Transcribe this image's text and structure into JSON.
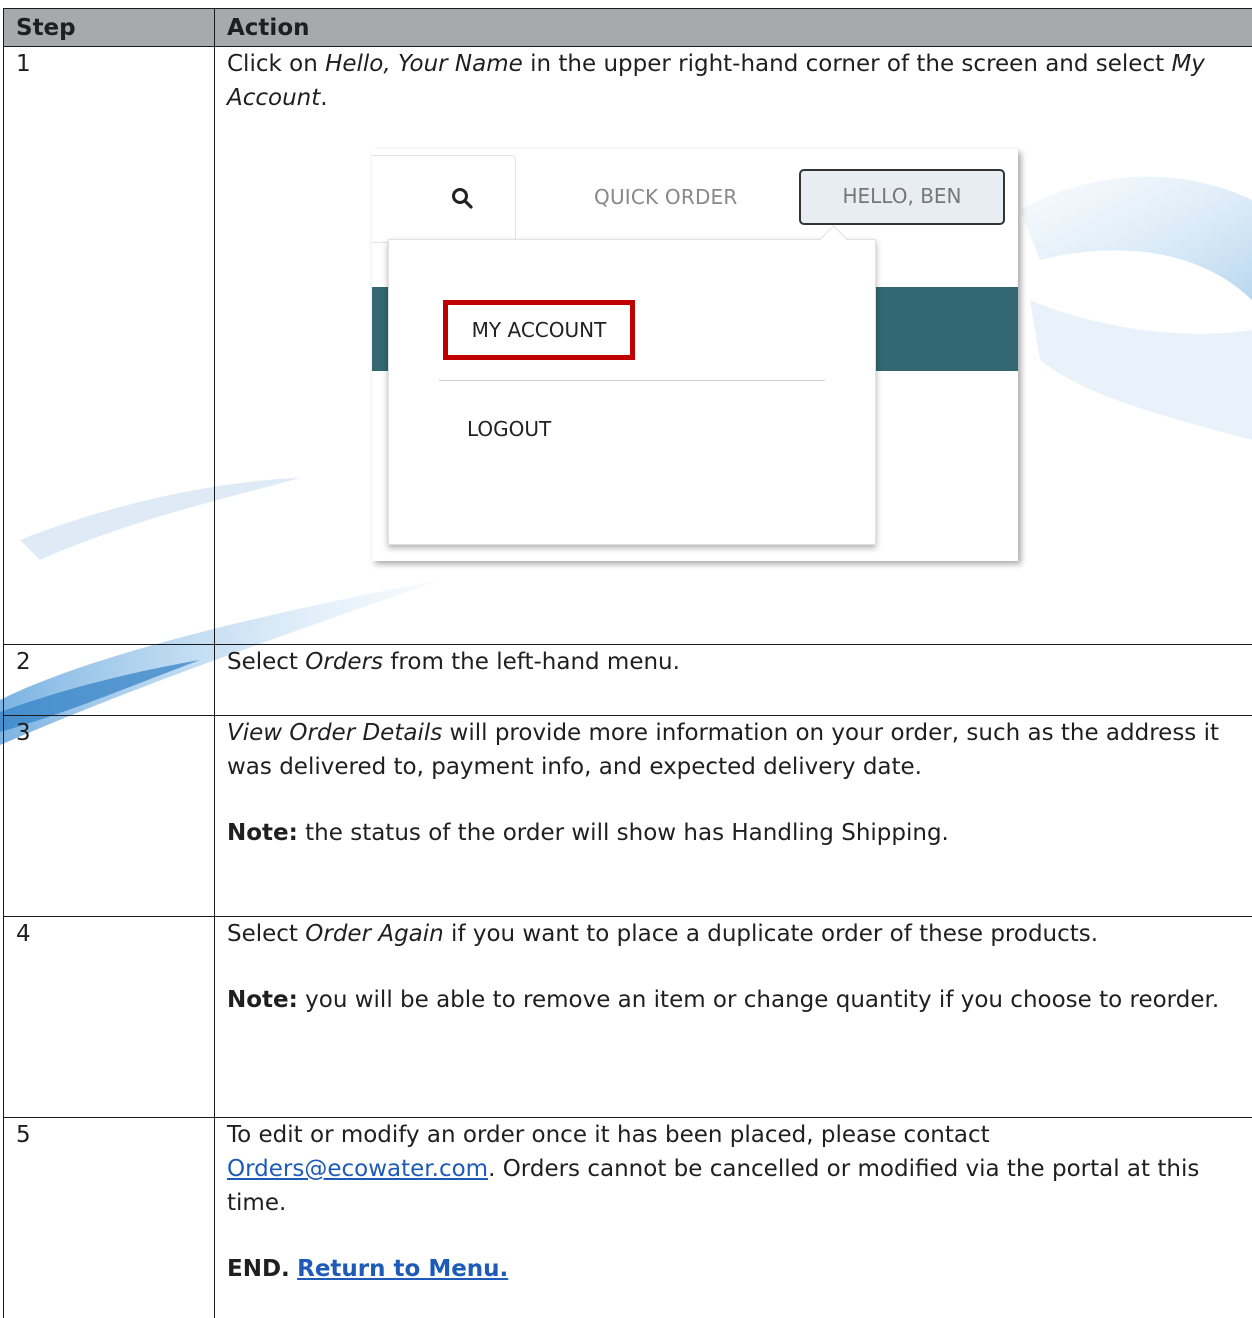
{
  "table": {
    "header": {
      "step": "Step",
      "action": "Action"
    },
    "rows": [
      {
        "num": "1",
        "pre": "Click on ",
        "em1": "Hello, Your Name",
        "mid": " in the upper right-hand corner of the screen and select ",
        "em2": "My Account",
        "post": "."
      },
      {
        "num": "2",
        "pre": "Select ",
        "em1": "Orders",
        "post": " from the left-hand menu."
      },
      {
        "num": "3",
        "em1": "View Order Details",
        "post": " will provide more information on your order, such as the address it was delivered to, payment info, and expected delivery date.",
        "note_label": "Note:",
        "note_text": " the status of the order will show has Handling Shipping."
      },
      {
        "num": "4",
        "pre": "Select ",
        "em1": "Order Again",
        "post": " if you want to place a duplicate order of these products.",
        "note_label": "Note:",
        "note_text": " you will be able to remove an item or change quantity if you choose to reorder."
      },
      {
        "num": "5",
        "pre": "To edit or modify an order once it has been placed, please contact ",
        "email": "Orders@ecowater.com",
        "post": ". Orders cannot be cancelled or modified via the portal at this time.",
        "end_label": "END.",
        "return_link": "Return to Menu."
      }
    ]
  },
  "screenshot": {
    "quick_order": "QUICK ORDER",
    "hello_button": "HELLO, BEN",
    "menu": {
      "my_account": "MY ACCOUNT",
      "logout": "LOGOUT"
    },
    "highlight_color": "#c00000",
    "teal_color": "#336771"
  }
}
